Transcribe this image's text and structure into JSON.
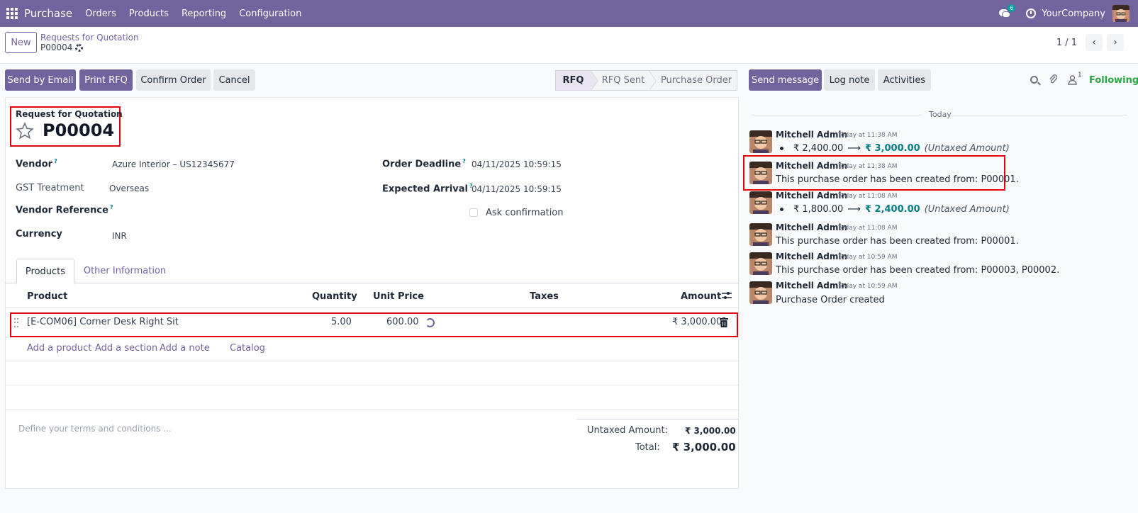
{
  "navbar": {
    "app_name": "Purchase",
    "menu": [
      "Orders",
      "Products",
      "Reporting",
      "Configuration"
    ],
    "messages_badge": "6",
    "company": "YourCompany"
  },
  "control_panel": {
    "new_label": "New",
    "breadcrumb_parent": "Requests for Quotation",
    "breadcrumb_current": "P00004",
    "pager": "1 / 1"
  },
  "actions": {
    "send_email": "Send by Email",
    "print_rfq": "Print RFQ",
    "confirm_order": "Confirm Order",
    "cancel": "Cancel"
  },
  "status": {
    "stages": [
      "RFQ",
      "RFQ Sent",
      "Purchase Order"
    ],
    "active": "RFQ"
  },
  "form": {
    "title_label": "Request for Quotation",
    "title": "P00004",
    "vendor_label": "Vendor",
    "vendor": "Azure Interior – US12345677",
    "gst_label": "GST Treatment",
    "gst": "Overseas",
    "vendor_ref_label": "Vendor Reference",
    "currency_label": "Currency",
    "currency": "INR",
    "order_deadline_label": "Order Deadline",
    "order_deadline": "04/11/2025 10:59:15",
    "expected_arrival_label": "Expected Arrival",
    "expected_arrival": "04/11/2025 10:59:15",
    "ask_confirmation": "Ask confirmation",
    "help_mark": "?"
  },
  "tabs": [
    "Products",
    "Other Information"
  ],
  "table": {
    "headers": {
      "product": "Product",
      "quantity": "Quantity",
      "unit_price": "Unit Price",
      "taxes": "Taxes",
      "amount": "Amount"
    },
    "rows": [
      {
        "product": "[E-COM06] Corner Desk Right Sit",
        "quantity": "5.00",
        "unit_price": "600.00",
        "taxes": "",
        "amount": "₹ 3,000.00"
      }
    ],
    "add_links": [
      "Add a product",
      "Add a section",
      "Add a note",
      "Catalog"
    ]
  },
  "terms_placeholder": "Define your terms and conditions ...",
  "totals": {
    "untaxed_label": "Untaxed Amount:",
    "untaxed": "₹ 3,000.00",
    "total_label": "Total:",
    "total": "₹ 3,000.00"
  },
  "chatter": {
    "send_message": "Send message",
    "log_note": "Log note",
    "activities": "Activities",
    "followers_count": "1",
    "following": "Following",
    "day_separator": "Today",
    "messages": [
      {
        "author": "Mitchell Admin",
        "date": "Today at 11:38 AM",
        "type": "tracking",
        "old": "₹ 2,400.00",
        "new": "₹ 3,000.00",
        "field": "(Untaxed Amount)"
      },
      {
        "author": "Mitchell Admin",
        "date": "Today at 11:38 AM",
        "type": "text",
        "body": "This purchase order has been created from: P00001."
      },
      {
        "author": "Mitchell Admin",
        "date": "Today at 11:08 AM",
        "type": "tracking",
        "old": "₹ 1,800.00",
        "new": "₹ 2,400.00",
        "field": "(Untaxed Amount)"
      },
      {
        "author": "Mitchell Admin",
        "date": "Today at 11:08 AM",
        "type": "text",
        "body": "This purchase order has been created from: P00001."
      },
      {
        "author": "Mitchell Admin",
        "date": "Today at 10:59 AM",
        "type": "text",
        "body": "This purchase order has been created from: P00003, P00002."
      },
      {
        "author": "Mitchell Admin",
        "date": "Today at 10:59 AM",
        "type": "text",
        "body": "Purchase Order created"
      }
    ]
  },
  "colors": {
    "brand": "#71639e",
    "highlight": "#e3000f",
    "following": "#28a745",
    "accent_teal": "#017e84"
  }
}
